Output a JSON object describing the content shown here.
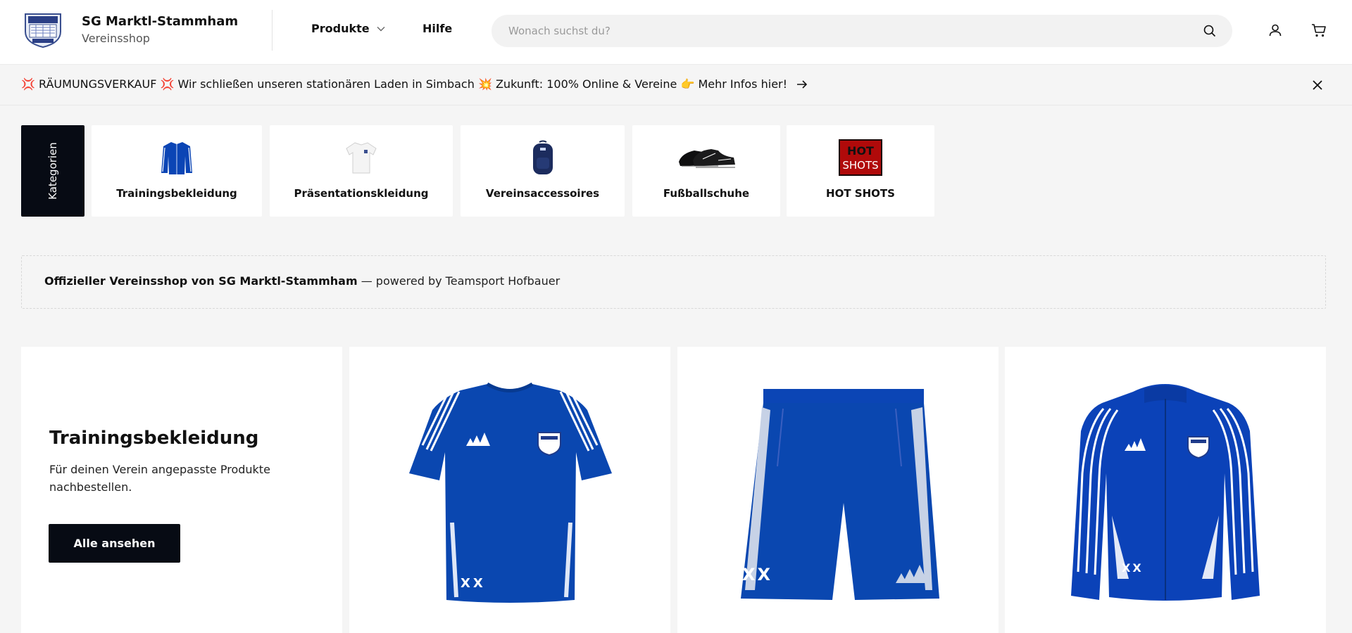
{
  "header": {
    "brand_name": "SG Marktl-Stammham",
    "brand_sub": "Vereinsshop",
    "nav": {
      "produkte": "Produkte",
      "hilfe": "Hilfe"
    },
    "search": {
      "placeholder": "Wonach suchst du?",
      "value": ""
    },
    "icons": [
      "search-icon",
      "user-icon",
      "cart-icon"
    ]
  },
  "announcement": {
    "text": "💢 RÄUMUNGSVERKAUF 💢 Wir schließen unseren stationären Laden in Simbach 💥 Zukunft: 100% Online & Vereine 👉 Mehr Infos hier!"
  },
  "categories": {
    "tab_label": "Kategorien",
    "items": [
      {
        "label": "Trainingsbekleidung"
      },
      {
        "label": "Präsentationskleidung"
      },
      {
        "label": "Vereinsaccessoires"
      },
      {
        "label": "Fußballschuhe"
      },
      {
        "label": "HOT SHOTS"
      }
    ],
    "hot_shots_logo_text": [
      "HOT",
      "SHOTS"
    ]
  },
  "info": {
    "bold": "Offizieller Vereinsshop von SG Marktl-Stammham",
    "rest": " — powered by Teamsport Hofbauer"
  },
  "promo": {
    "title": "Trainingsbekleidung",
    "description": "Für deinen Verein angepasste Produkte nachbestellen.",
    "button": "Alle ansehen"
  },
  "products": [
    {
      "name": "jersey",
      "print": "XX"
    },
    {
      "name": "shorts",
      "print": "XX"
    },
    {
      "name": "track-jacket",
      "print": "XX"
    }
  ],
  "colors": {
    "brand_blue": "#0a47b0",
    "dark": "#070b14",
    "background": "#f5f5f5"
  }
}
